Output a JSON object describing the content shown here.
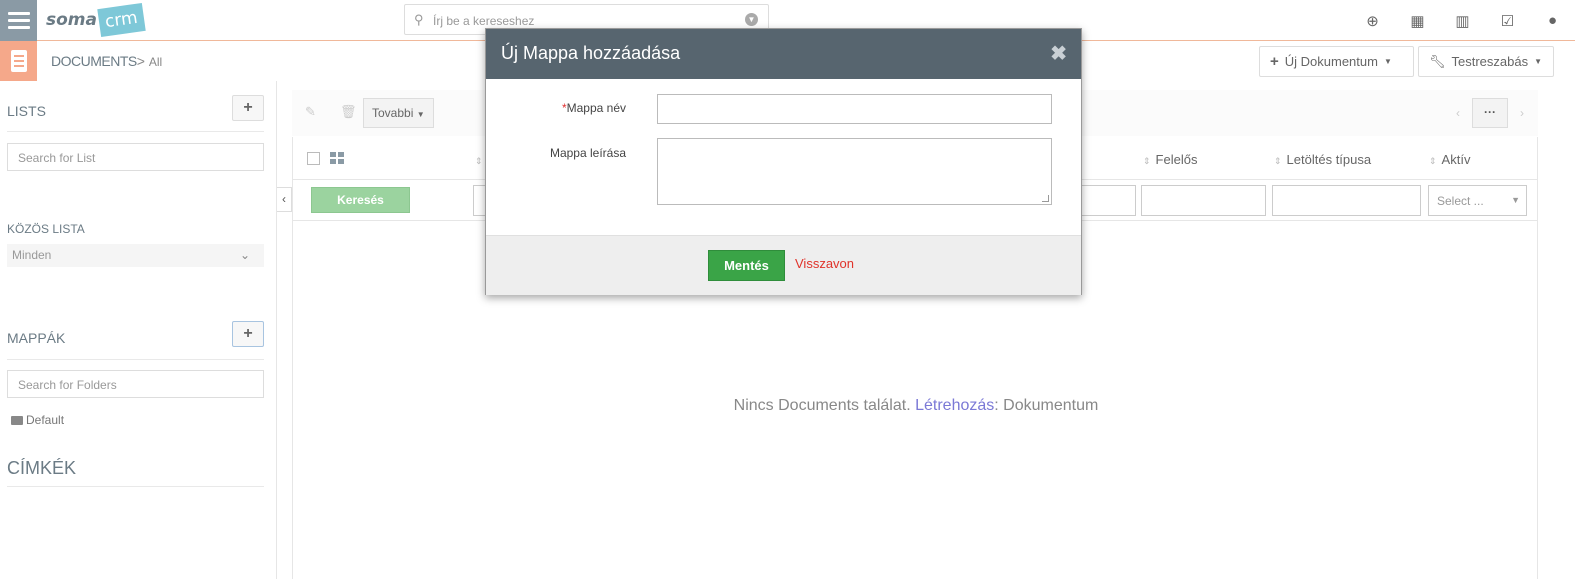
{
  "topbar": {
    "logo_main": "soma",
    "logo_accent": "crm",
    "search_placeholder": "Írj be a kereseshez",
    "icons": [
      "plus-circle-icon",
      "calendar-icon",
      "chart-icon",
      "check-square-icon",
      "user-icon"
    ]
  },
  "header": {
    "breadcrumb_main": "DOCUMENTS",
    "breadcrumb_sep": ">",
    "breadcrumb_sub": "All",
    "new_doc_label": "Új Dokumentum",
    "customize_label": "Testreszabás"
  },
  "sidebar": {
    "lists_title": "LISTS",
    "lists_search_placeholder": "Search for List",
    "shared_title": "KÖZÖS LISTA",
    "shared_value": "Minden",
    "folders_title": "MAPPÁK",
    "folders_search_placeholder": "Search for Folders",
    "folders": [
      "Default"
    ],
    "tags_title": "CÍMKÉK",
    "add_label": "+"
  },
  "toolbar": {
    "more_label": "Tovabbi",
    "pager_more": "···"
  },
  "grid": {
    "columns": [
      "Felelős",
      "Letöltés típusa",
      "Aktív"
    ],
    "search_button": "Keresés",
    "select_placeholder": "Select ...",
    "empty_text_1": "Nincs Documents találat.",
    "empty_link": "Létrehozás",
    "empty_text_2": ": Dokumentum"
  },
  "modal": {
    "title": "Új Mappa hozzáadása",
    "close_symbol": "✖",
    "name_required_mark": "*",
    "name_label": "Mappa név",
    "desc_label": "Mappa leírása",
    "save_label": "Mentés",
    "cancel_label": "Visszavon"
  },
  "colors": {
    "accent_orange": "#f5a88a",
    "modal_header": "#57656f",
    "save_green": "#3aa447",
    "cancel_red": "#e0332a",
    "link_purple": "#7b79d6"
  }
}
